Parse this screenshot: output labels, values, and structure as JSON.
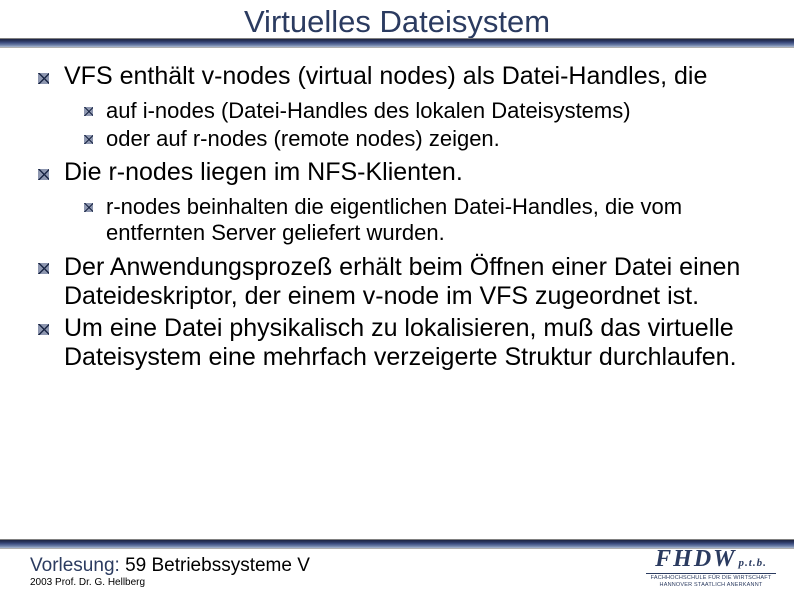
{
  "title": "Virtuelles Dateisystem",
  "bullets": {
    "b1": "VFS enthält v-nodes (virtual nodes) als Datei-Handles, die",
    "b1_sub": {
      "s1": "auf i-nodes (Datei-Handles des lokalen Dateisystems)",
      "s2": "oder auf r-nodes (remote nodes) zeigen."
    },
    "b2": "Die r-nodes liegen im NFS-Klienten.",
    "b2_sub": {
      "s1": "r-nodes beinhalten die eigentlichen Datei-Handles, die vom entfernten Server geliefert wurden."
    },
    "b3": "Der Anwendungsprozeß erhält beim Öffnen einer Datei einen Dateideskriptor, der einem v-node im VFS zugeordnet ist.",
    "b4": "Um eine Datei physikalisch zu lokalisieren, muß das virtuelle Dateisystem eine mehrfach verzeigerte Struktur durchlaufen."
  },
  "footer": {
    "lecture_label": "Vorlesung:",
    "lecture_rest": " 59 Betriebssysteme V",
    "copyright": "2003 Prof. Dr. G. Hellberg"
  },
  "logo": {
    "name": "FHDW",
    "ext": "p.t.b.",
    "line1": "FACHHOCHSCHULE FÜR DIE WIRTSCHAFT",
    "line2": "HANNOVER      STAATLICH ANERKANNT"
  }
}
